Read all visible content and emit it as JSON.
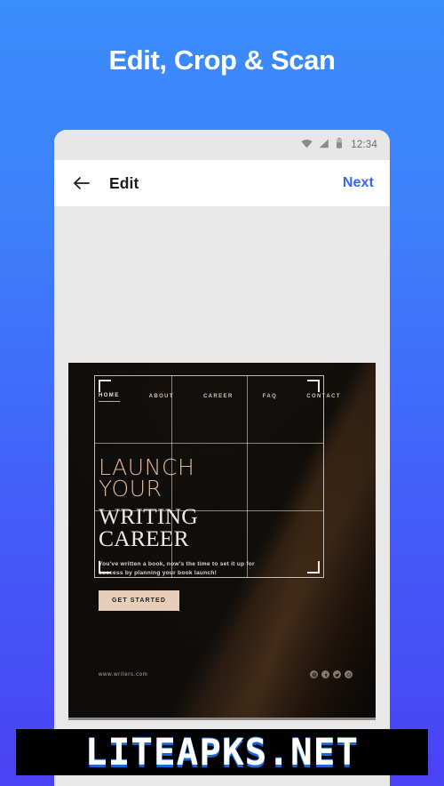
{
  "promo": {
    "headline": "Edit, Crop & Scan"
  },
  "phone": {
    "statusbar": {
      "time": "12:34",
      "icons": [
        "wifi-icon",
        "signal-icon",
        "battery-icon"
      ]
    },
    "appbar": {
      "back_icon": "back-arrow-icon",
      "title": "Edit",
      "next_label": "Next"
    }
  },
  "photo": {
    "nav": [
      {
        "label": "HOME",
        "active": true
      },
      {
        "label": "ABOUT",
        "active": false
      },
      {
        "label": "CAREER",
        "active": false
      },
      {
        "label": "FAQ",
        "active": false
      },
      {
        "label": "CONTACT",
        "active": false
      }
    ],
    "hero": {
      "line1a": "LAUNCH",
      "line1b": "YOUR",
      "line2a": "WRITING",
      "line2b": "CAREER",
      "subtitle": "You've written a book, now's the time to set it up for success by planning your book launch!",
      "cta_label": "GET STARTED"
    },
    "footer": {
      "url": "www.writers.com",
      "socials": [
        "instagram-icon",
        "facebook-icon",
        "twitter-icon",
        "whatsapp-icon"
      ]
    }
  },
  "crop_overlay": {
    "grid": "rule-of-thirds",
    "handles": [
      "top-left",
      "top-right",
      "bottom-left",
      "bottom-right"
    ]
  },
  "watermark": {
    "text": "LITEAPKS.NET"
  },
  "colors": {
    "gradient_top": "#3b8cfd",
    "gradient_bottom": "#4a42f5",
    "accent_link": "#3a66ee",
    "cta_bg": "#e8cdb8",
    "hero_tan": "#dcb79c",
    "statusbar_bg": "#e7e7e7",
    "canvas_bg": "#e8e8e8"
  }
}
